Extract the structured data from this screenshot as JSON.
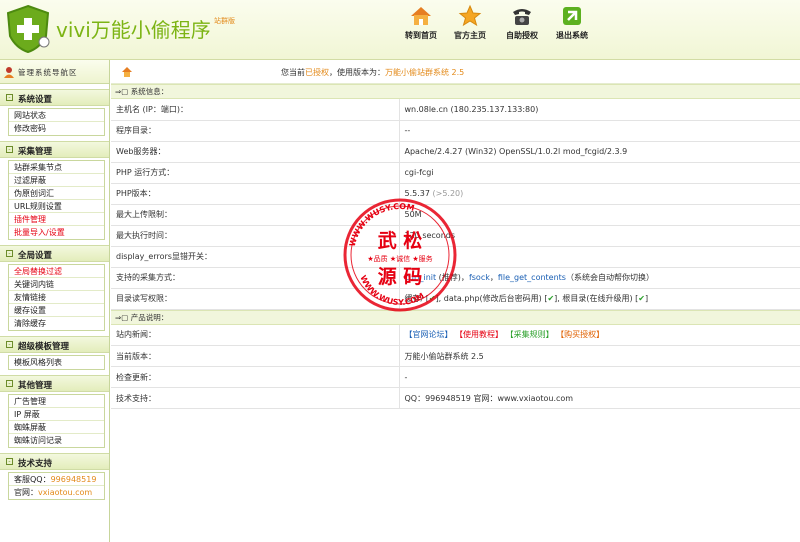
{
  "header": {
    "logo_text": "vivi万能小偷程序",
    "logo_sub": "站群版",
    "nav": [
      {
        "label": "转到首页",
        "icon": "home-icon"
      },
      {
        "label": "官方主页",
        "icon": "star-icon"
      },
      {
        "label": "自助授权",
        "icon": "phone-icon"
      },
      {
        "label": "退出系统",
        "icon": "exit-icon"
      }
    ]
  },
  "sidebar": {
    "title": "管理系统导航区",
    "sections": [
      {
        "title": "系统设置",
        "items": [
          "网站状态",
          "修改密码"
        ]
      },
      {
        "title": "采集管理",
        "items": [
          "站群采集节点",
          "过滤屏蔽",
          "伪原创词汇",
          "URL规则设置",
          "插件管理",
          "批量导入/设置"
        ]
      },
      {
        "title": "全局设置",
        "items": [
          "全局替换过滤",
          "关键词内链",
          "友情链接",
          "缓存设置",
          "清除缓存"
        ]
      },
      {
        "title": "超级模板管理",
        "items": [
          "模板风格列表"
        ]
      },
      {
        "title": "其他管理",
        "items": [
          "广告管理",
          "IP 屏蔽",
          "蜘蛛屏蔽",
          "蜘蛛访问记录"
        ]
      },
      {
        "title": "技术支持",
        "items": []
      }
    ],
    "support": {
      "qq_label": "客服QQ：",
      "qq_value": "996948519",
      "site_label": "官网：",
      "site_value": "vxiaotou.com"
    }
  },
  "main": {
    "status": {
      "prefix": "您当前",
      "auth": "已授权",
      "mid": "，使用版本为：",
      "version": "万能小偷站群系统 2.5"
    },
    "sys_head": "系统信息：",
    "sys_rows": {
      "host_k": "主机名 (IP：端口)：",
      "host_v": "wn.08le.cn  (180.235.137.133:80)",
      "dir_k": "程序目录：",
      "dir_v": "--",
      "web_k": "Web服务器：",
      "web_v": "Apache/2.4.27 (Win32) OpenSSL/1.0.2l mod_fcgid/2.3.9",
      "phpmode_k": "PHP 运行方式：",
      "phpmode_v": "cgi-fcgi",
      "phpver_k": "PHP版本：",
      "phpver_v": "5.5.37",
      "phpver_note": "(>5.20)",
      "upload_k": "最大上传限制：",
      "upload_v": "50M",
      "exec_k": "最大执行时间：",
      "exec_v": "120 seconds",
      "display_k": "display_errors显错开关：",
      "display_v": "",
      "collect_k": "支持的采集方式：",
      "collect_v1": "curl_init",
      "collect_v2": " (推荐)，",
      "collect_v3": "fsock",
      "collect_v4": "，",
      "collect_v5": "file_get_contents",
      "collect_v6": "（系统会自动帮你切换）",
      "perm_k": "目录读写权限：",
      "perm_v1": "缓存",
      "perm_v2": "/ [",
      "perm_v3": "✔",
      "perm_v4": "],  data.php(修改后台密码用) [",
      "perm_v5": "✔",
      "perm_v6": "],  根目录(在线升级用) [",
      "perm_v7": "✔",
      "perm_v8": "]"
    },
    "prod_head": "产品说明：",
    "prod_rows": {
      "news_k": "站内新闻：",
      "news_links": [
        "【官网论坛】",
        "【使用教程】",
        "【采集规则】",
        "【购买授权】"
      ],
      "ver_k": "当前版本：",
      "ver_v": "万能小偷站群系统 2.5",
      "upd_k": "检查更新：",
      "upd_v": "-",
      "tech_k": "技术支持：",
      "tech_v": "QQ：996948519    官网：www.vxiaotou.com"
    }
  },
  "watermark": {
    "top": "武 松",
    "bottom": "源 码",
    "mid": "★品质 ★诚信 ★服务",
    "ring": "WWW.WUSY.COM"
  },
  "colors": {
    "accent": "#7cb414",
    "orange": "#e38a1a",
    "red": "#e60012"
  }
}
